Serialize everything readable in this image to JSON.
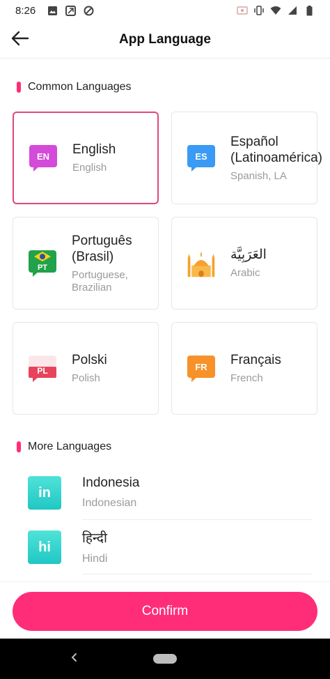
{
  "status_bar": {
    "time": "8:26",
    "icons_left": [
      "image-icon",
      "box-icon",
      "at-icon"
    ],
    "icons_right": [
      "screen-cast-icon",
      "vibrate-icon",
      "wifi-icon",
      "signal-icon",
      "battery-icon"
    ]
  },
  "header": {
    "title": "App Language",
    "back_icon": "arrow-left-icon"
  },
  "common": {
    "title": "Common Languages",
    "items": [
      {
        "code": "EN",
        "name": "English",
        "sub": "English",
        "color": "#d34bd8",
        "selected": true
      },
      {
        "code": "ES",
        "name": "Español (Latinoamérica)",
        "sub": "Spanish, LA",
        "color": "#3a9af4",
        "selected": false
      },
      {
        "code": "PT",
        "name": "Português (Brasil)",
        "sub": "Portuguese, Brazilian",
        "color": "#22a24a",
        "selected": false
      },
      {
        "code": "",
        "name": "العَرَبِيَّة",
        "sub": "Arabic",
        "color": "#f6a12d",
        "selected": false
      },
      {
        "code": "PL",
        "name": "Polski",
        "sub": "Polish",
        "color": "#e8435c",
        "selected": false
      },
      {
        "code": "FR",
        "name": "Français",
        "sub": "French",
        "color": "#f7922a",
        "selected": false
      }
    ]
  },
  "more": {
    "title": "More Languages",
    "items": [
      {
        "code": "in",
        "name": "Indonesia",
        "sub": "Indonesian"
      },
      {
        "code": "hi",
        "name": "हिन्दी",
        "sub": "Hindi"
      }
    ]
  },
  "confirm_label": "Confirm",
  "colors": {
    "accent": "#ff2d78",
    "selected_border": "#e0457b",
    "teal": "#2fd1cc"
  }
}
